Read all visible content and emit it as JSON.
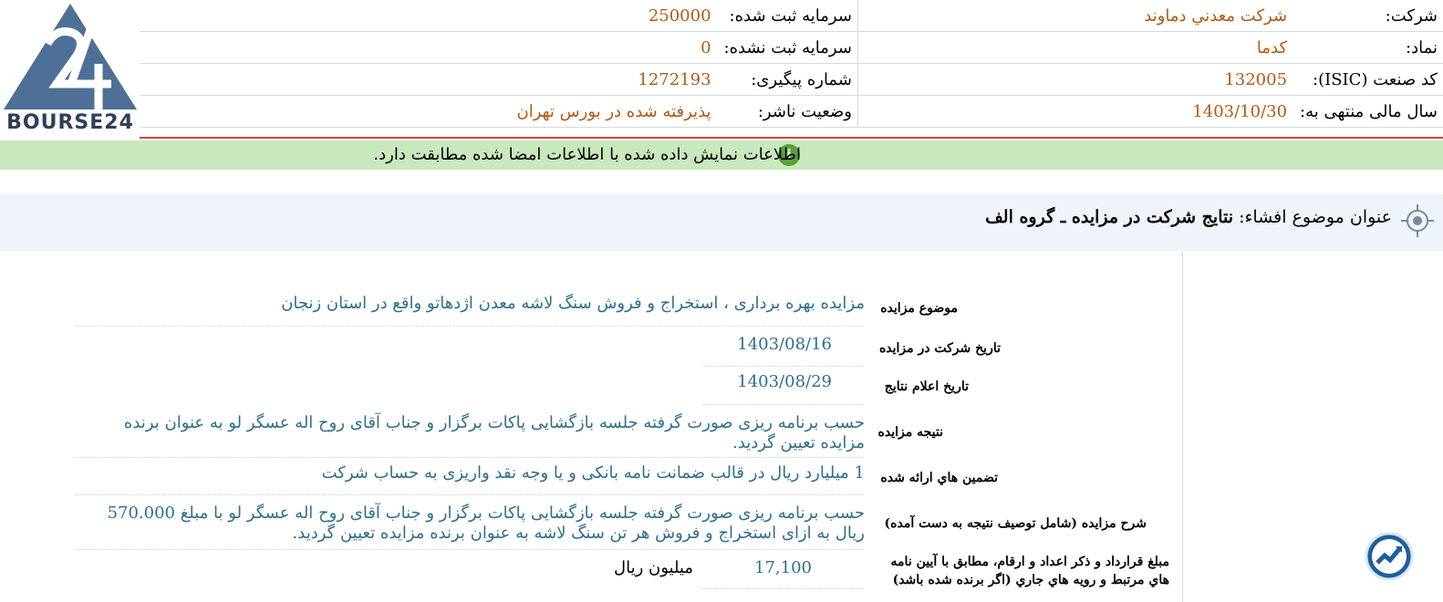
{
  "logo": {
    "text": "BOURSE24"
  },
  "header": {
    "company_label": "شرکت:",
    "company_value": "شرکت معدني دماوند",
    "symbol_label": "نماد:",
    "symbol_value": "کدما",
    "isic_label": "کد صنعت (ISIC):",
    "isic_value": "132005",
    "fiscal_label": "سال مالی منتهی به:",
    "fiscal_value": "1403/10/30",
    "capital_label": "سرمایه ثبت شده:",
    "capital_value": "250000",
    "unregistered_label": "سرمایه ثبت نشده:",
    "unregistered_value": "0",
    "tracking_label": "شماره پیگیری:",
    "tracking_value": "1272193",
    "status_label": "وضعیت ناشر:",
    "status_value": "پذیرفته شده در بورس تهران"
  },
  "notice": {
    "text": "اطلاعات نمایش داده شده با اطلاعات امضا شده مطابقت دارد."
  },
  "subject": {
    "label": "عنوان موضوع افشاء:",
    "title": "نتایج شرکت در مزایده ـ گروه الف"
  },
  "details": {
    "subject_label": "موضوع مزایده",
    "subject_value": "مزایده بهره برداری ، استخراج و فروش سنگ لاشه معدن اژدهاتو واقع در استان زنجان",
    "participation_label": "تاریخ شرکت در مزایده",
    "participation_value": "1403/08/16",
    "announce_label": "تاریخ اعلام نتایج",
    "announce_value": "1403/08/29",
    "result_label": "نتیجه مزایده",
    "result_value": "حسب برنامه ریزی صورت گرفته جلسه بازگشایی پاکات برگزار و جناب آقای روح اله عسگر لو به عنوان برنده مزایده تعیین گردید.",
    "guarantee_label": "تضمین هاي ارائه شده",
    "guarantee_value": "1 میلیارد ریال در قالب ضمانت نامه بانکی و یا وجه نقد واریزی به حساب شرکت",
    "desc_label": "شرح مزایده (شامل توصیف نتیجه به دست آمده)",
    "desc_value": "حسب برنامه ریزی صورت گرفته جلسه بازگشایی پاکات برگزار و جناب آقای روح اله عسگر لو با مبلغ 570.000 ریال به ازای استخراج و فروش هر تن سنگ لاشه به عنوان برنده مزایده تعیین گردید.",
    "amount_label": "مبلغ قرارداد و ذکر اعداد و ارقام، مطابق با آیین نامه هاي مرتبط و رویه هاي جاري (اگر برنده شده باشد)",
    "amount_value": "17,100",
    "amount_unit": "میلیون ریال"
  }
}
